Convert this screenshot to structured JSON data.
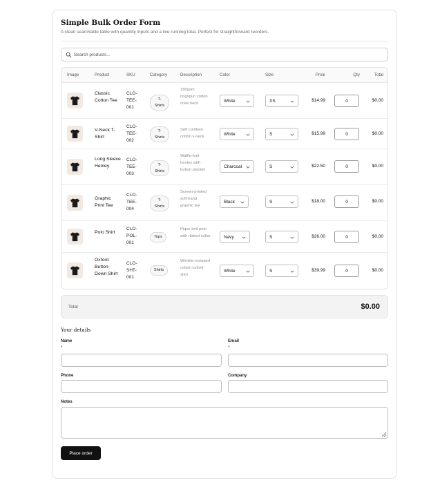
{
  "form": {
    "title": "Simple Bulk Order Form",
    "subtitle": "A clean searchable table with quantity inputs and a live running total. Perfect for straightforward reorders."
  },
  "search": {
    "placeholder": "Search products..."
  },
  "table": {
    "headers": {
      "image": "Image",
      "product": "Product",
      "sku": "SKU",
      "category": "Category",
      "description": "Description",
      "color": "Color",
      "size": "Size",
      "price": "Price",
      "qty": "Qty",
      "total": "Total"
    },
    "rows": [
      {
        "product": "Classic Cotton Tee",
        "sku": "CLO-TEE-001",
        "category": "T-Shirts",
        "description": "180gsm ringspun cotton crew neck",
        "color": "White",
        "size": "XS",
        "price": "$14.99",
        "qty": "0",
        "total": "$0.00"
      },
      {
        "product": "V-Neck T-Shirt",
        "sku": "CLO-TEE-002",
        "category": "T-Shirts",
        "description": "Soft combed cotton v-neck",
        "color": "White",
        "size": "S",
        "price": "$15.99",
        "qty": "0",
        "total": "$0.00"
      },
      {
        "product": "Long Sleeve Henley",
        "sku": "CLO-TEE-003",
        "category": "T-Shirts",
        "description": "Waffle-knit henley with button placket",
        "color": "Charcoal",
        "size": "S",
        "price": "$22.50",
        "qty": "0",
        "total": "$0.00"
      },
      {
        "product": "Graphic Print Tee",
        "sku": "CLO-TEE-004",
        "category": "T-Shirts",
        "description": "Screen-printed soft-hand graphic tee",
        "color": "Black",
        "size": "S",
        "price": "$18.00",
        "qty": "0",
        "total": "$0.00"
      },
      {
        "product": "Polo Shirt",
        "sku": "CLO-POL-001",
        "category": "Tops",
        "description": "Pique knit polo with ribbed collar",
        "color": "Navy",
        "size": "S",
        "price": "$26.00",
        "qty": "0",
        "total": "$0.00"
      },
      {
        "product": "Oxford Button-Down Shirt",
        "sku": "CLO-SHT-001",
        "category": "Shirts",
        "description": "Wrinkle-resistant cotton oxford shirt",
        "color": "White",
        "size": "S",
        "price": "$39.99",
        "qty": "0",
        "total": "$0.00"
      }
    ]
  },
  "totals": {
    "label": "Total",
    "value": "$0.00"
  },
  "details": {
    "title": "Your details",
    "name_label": "Name",
    "email_label": "Email",
    "phone_label": "Phone",
    "company_label": "Company",
    "notes_label": "Notes",
    "required_mark": "*"
  },
  "submit": {
    "label": "Place order"
  },
  "icons": {
    "search": "search-icon",
    "thumbnail": "tshirt-icon",
    "dropdown": "chevron-down-icon",
    "resize": "resize-grip-icon"
  },
  "colors": {
    "accent": "#111111",
    "required": "#c0392b",
    "thumbnail_bg": "#f1e9e2"
  }
}
